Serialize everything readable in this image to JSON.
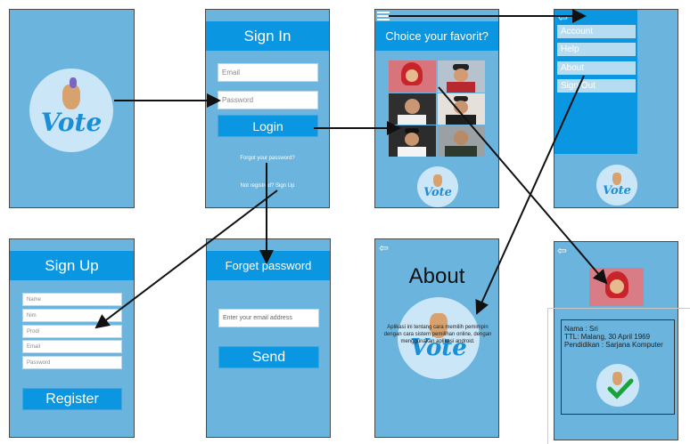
{
  "splash": {
    "logo_text": "Vote"
  },
  "signin": {
    "title": "Sign In",
    "email_placeholder": "Email",
    "password_placeholder": "Password",
    "login_label": "Login",
    "forgot_link": "Forgot your password?",
    "signup_link": "Not registred? Sign Up"
  },
  "choice": {
    "title": "Choice your favorit?",
    "logo_text": "Vote"
  },
  "menu": {
    "items": [
      {
        "label": "Account"
      },
      {
        "label": "Help"
      },
      {
        "label": "About"
      },
      {
        "label": "Sign Out"
      }
    ],
    "logo_text": "Vote"
  },
  "signup": {
    "title": "Sign Up",
    "fields": [
      {
        "placeholder": "Name"
      },
      {
        "placeholder": "Nim"
      },
      {
        "placeholder": "Prodi"
      },
      {
        "placeholder": "Email"
      },
      {
        "placeholder": "Password"
      }
    ],
    "register_label": "Register"
  },
  "forgot": {
    "title": "Forget password",
    "email_placeholder": "Enter your email address",
    "send_label": "Send"
  },
  "about": {
    "title": "About",
    "description": "Aplikasi ini tentang cara memilih pemimpin dengan cara sistem pemilihan online, dengan menggunakan aplikasi android.",
    "logo_text": "Vote"
  },
  "profile": {
    "name_line": "Nama : Sri",
    "ttl_line": "TTL: Malang, 30 April 1969",
    "edu_line": "Pendidikan : Sarjana Komputer"
  },
  "colors": {
    "screen_bg": "#6ab4de",
    "bar": "#0a96e0",
    "arrow": "#111111",
    "check": "#1aa33a"
  },
  "icons": [
    "hamburger-icon",
    "back-arrow-icon",
    "vote-logo",
    "checkmark-icon"
  ]
}
